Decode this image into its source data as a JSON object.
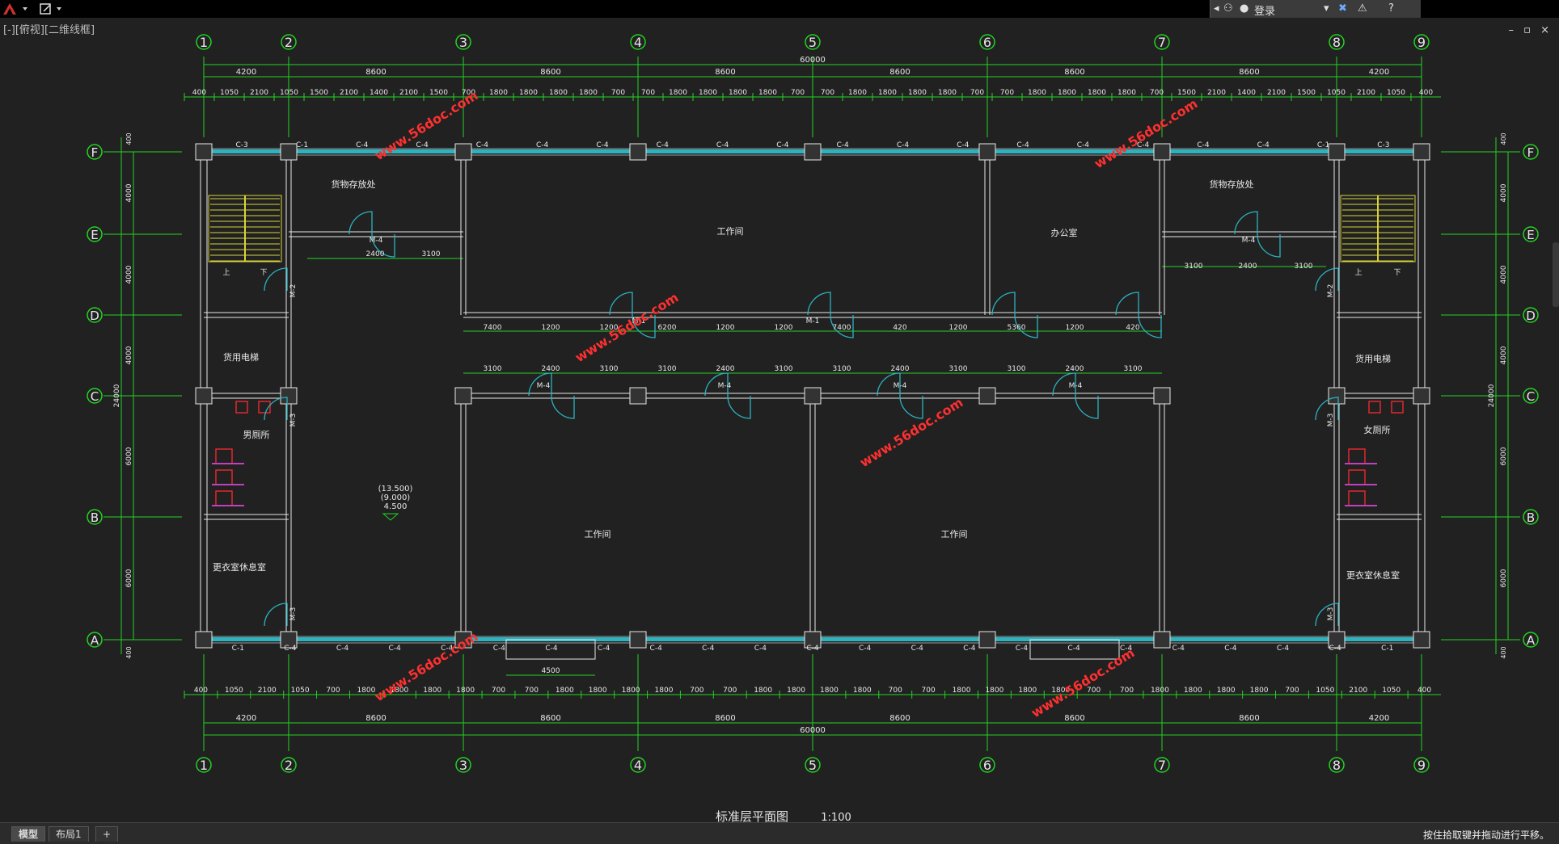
{
  "viewport_label": "[-][俯视][二维线框]",
  "login": {
    "label": "登录"
  },
  "window_controls": {
    "minimize": "–",
    "restore": "▫",
    "close": "×"
  },
  "tabs": {
    "model": "模型",
    "layout1": "布局1",
    "add": "+"
  },
  "status": {
    "message": "按住拾取键并拖动进行平移。"
  },
  "drawing": {
    "title": "标准层平面图",
    "scale": "1:100",
    "grid_columns": [
      "1",
      "2",
      "3",
      "4",
      "5",
      "6",
      "7",
      "8",
      "9"
    ],
    "grid_rows": [
      "F",
      "E",
      "D",
      "C",
      "B",
      "A"
    ],
    "total_dim": "60000",
    "bay_dims": [
      "4200",
      "8600",
      "8600",
      "8600",
      "8600",
      "8600",
      "8600",
      "4200"
    ],
    "top_detail_dims": [
      "400",
      "1050",
      "2100",
      "1050",
      "1500",
      "2100",
      "1400",
      "2100",
      "1500",
      "700",
      "1800",
      "1800",
      "1800",
      "1800",
      "700",
      "700",
      "1800",
      "1800",
      "1800",
      "1800",
      "700",
      "700",
      "1800",
      "1800",
      "1800",
      "1800",
      "700",
      "700",
      "1800",
      "1800",
      "1800",
      "1800",
      "700",
      "1500",
      "2100",
      "1400",
      "2100",
      "1500",
      "1050",
      "2100",
      "1050",
      "400"
    ],
    "bottom_detail_dims": [
      "400",
      "1050",
      "2100",
      "1050",
      "700",
      "1800",
      "1800",
      "1800",
      "1800",
      "700",
      "700",
      "1800",
      "1800",
      "1800",
      "1800",
      "700",
      "700",
      "1800",
      "1800",
      "1800",
      "1800",
      "700",
      "700",
      "1800",
      "1800",
      "1800",
      "1800",
      "700",
      "700",
      "1800",
      "1800",
      "1800",
      "1800",
      "700",
      "1050",
      "2100",
      "1050",
      "400"
    ],
    "side_dims": [
      "4000",
      "4000",
      "4000",
      "6000",
      "6000"
    ],
    "side_small": [
      "400",
      "400"
    ],
    "side_total": "24000",
    "windows_top": [
      "C-3",
      "C-1",
      "C-4",
      "C-4",
      "C-4",
      "C-4",
      "C-4",
      "C-4",
      "C-4",
      "C-4",
      "C-4",
      "C-4",
      "C-4",
      "C-4",
      "C-4",
      "C-4",
      "C-4",
      "C-4",
      "C-1",
      "C-3"
    ],
    "windows_bottom": [
      "C-1",
      "C-4",
      "C-4",
      "C-4",
      "C-4",
      "C-4",
      "C-4",
      "C-4",
      "C-4",
      "C-4",
      "C-4",
      "C-4",
      "C-4",
      "C-4",
      "C-4",
      "C-4",
      "C-4",
      "C-4",
      "C-4",
      "C-4",
      "C-4",
      "C-4",
      "C-1"
    ],
    "rooms": {
      "storage_left": "货物存放处",
      "storage_right": "货物存放处",
      "workshop_top": "工作间",
      "office": "办公室",
      "elevator_left": "货用电梯",
      "elevator_right": "货用电梯",
      "toilet_male": "男厕所",
      "toilet_female": "女厕所",
      "workshop_left": "工作间",
      "workshop_right": "工作间",
      "changing_left": "更衣室休息室",
      "changing_right": "更衣室休息室"
    },
    "doors": [
      "M-4",
      "M-4",
      "M-2",
      "M-2",
      "M-3",
      "M-3",
      "M-3",
      "M-3",
      "M-1",
      "M-1",
      "M-4",
      "M-4",
      "M-4",
      "M-4"
    ],
    "mid_dims_upper": [
      "7400",
      "1200",
      "1200",
      "6200",
      "1200",
      "1200",
      "7400",
      "420",
      "1200",
      "5360",
      "1200",
      "420"
    ],
    "mid_dims_lower": [
      "3100",
      "2400",
      "3100",
      "3100",
      "2400",
      "3100",
      "3100",
      "2400",
      "3100",
      "3100",
      "2400",
      "3100"
    ],
    "stair_dims_left": [
      "2400",
      "3100"
    ],
    "stair_dims_right": [
      "3100",
      "2400",
      "3100"
    ],
    "levels": [
      "(13.500)",
      "(9.000)",
      "4.500"
    ],
    "bottom_window_dim": "4500",
    "watermark": "www.56doc.com",
    "stair_up": "上",
    "stair_down": "下"
  }
}
